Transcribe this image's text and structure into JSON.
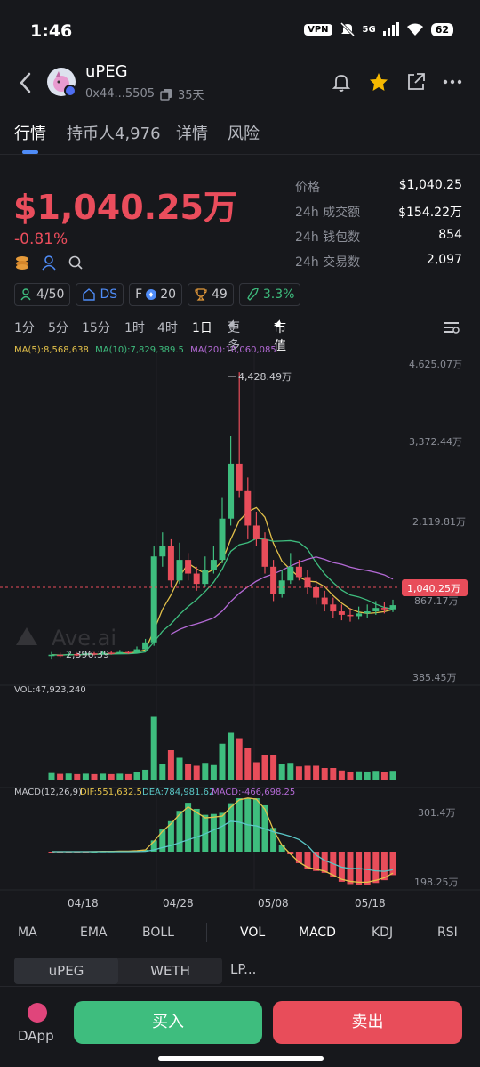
{
  "status": {
    "time": "1:46",
    "vpn": "VPN",
    "net": "5G",
    "battery": "62"
  },
  "header": {
    "name": "uPEG",
    "address": "0x44...5505",
    "age": "35天"
  },
  "tabs": [
    "行情",
    "持币人4,976",
    "详情",
    "风险"
  ],
  "price": {
    "main": "$1,040.25万",
    "change": "-0.81%"
  },
  "stats": [
    {
      "k": "价格",
      "v": "$1,040.25"
    },
    {
      "k": "24h 成交额",
      "v": "$154.22万"
    },
    {
      "k": "24h 钱包数",
      "v": "854"
    },
    {
      "k": "24h 交易数",
      "v": "2,097"
    }
  ],
  "tags": [
    {
      "icon": "holder-icon",
      "text": "4/50"
    },
    {
      "icon": "ds-icon",
      "text": "DS"
    },
    {
      "icon": "f-icon",
      "text": "20",
      "prefix": "F"
    },
    {
      "icon": "trophy-icon",
      "text": "49"
    },
    {
      "icon": "rocket-icon",
      "text": "3.3%"
    }
  ],
  "intervals": [
    "1分",
    "5分",
    "15分",
    "1时",
    "4时",
    "1日",
    "更多",
    "市值"
  ],
  "legend": {
    "ma5": "MA(5):8,568,638",
    "ma10": "MA(10):7,829,389.5",
    "ma20": "MA(20):10,060,085"
  },
  "axis": {
    "y_labels": [
      "4,625.07万",
      "3,372.44万",
      "2,119.81万",
      "867.17万",
      "385.45万"
    ],
    "high_label": "4,428.49万",
    "low_label": "2,396.39",
    "current_label": "1,040.25万",
    "x_labels": [
      "04/18",
      "04/28",
      "05/08",
      "05/18"
    ],
    "vol_label": "VOL:47,923,240",
    "macd_label": "MACD(12,26,9)",
    "dif_label": "DIF:551,632.5",
    "dea_label": "DEA:784,981.62",
    "macdv_label": "MACD:-466,698.25",
    "macd_top": "301.4万",
    "macd_bottom": "198.25万"
  },
  "indicators": [
    "MA",
    "EMA",
    "BOLL",
    "VOL",
    "MACD",
    "KDJ",
    "RSI"
  ],
  "pair": [
    "uPEG",
    "WETH",
    "LP..."
  ],
  "bottom": {
    "dapp": "DApp",
    "buy": "买入",
    "sell": "卖出"
  },
  "colors": {
    "up": "#3ebd7e",
    "down": "#e84d5a",
    "accent": "#4f8cf7"
  },
  "chart_data": {
    "type": "candlestick",
    "x_labels": [
      "04/18",
      "04/28",
      "05/08",
      "05/18"
    ],
    "candles": [
      [
        0.3,
        0.32,
        0.25,
        0.36
      ],
      [
        0.32,
        0.31,
        0.28,
        0.35
      ],
      [
        0.31,
        0.33,
        0.29,
        0.36
      ],
      [
        0.33,
        0.32,
        0.3,
        0.35
      ],
      [
        0.32,
        0.34,
        0.31,
        0.37
      ],
      [
        0.34,
        0.33,
        0.31,
        0.36
      ],
      [
        0.33,
        0.35,
        0.32,
        0.38
      ],
      [
        0.35,
        0.34,
        0.32,
        0.37
      ],
      [
        0.34,
        0.36,
        0.33,
        0.39
      ],
      [
        0.36,
        0.35,
        0.33,
        0.38
      ],
      [
        0.35,
        0.4,
        0.34,
        0.44
      ],
      [
        0.4,
        0.5,
        0.38,
        0.55
      ],
      [
        0.5,
        1.75,
        0.45,
        1.9
      ],
      [
        1.75,
        1.9,
        1.6,
        2.1
      ],
      [
        1.9,
        1.4,
        1.3,
        2.0
      ],
      [
        1.4,
        1.7,
        1.35,
        1.95
      ],
      [
        1.7,
        1.5,
        1.4,
        1.8
      ],
      [
        1.5,
        1.35,
        1.25,
        1.6
      ],
      [
        1.35,
        1.55,
        1.3,
        1.75
      ],
      [
        1.55,
        1.7,
        1.5,
        1.9
      ],
      [
        1.7,
        2.3,
        1.65,
        2.6
      ],
      [
        2.3,
        3.1,
        2.2,
        3.5
      ],
      [
        3.1,
        2.7,
        2.6,
        4.43
      ],
      [
        2.7,
        2.2,
        2.0,
        2.9
      ],
      [
        2.2,
        2.0,
        1.9,
        2.4
      ],
      [
        2.0,
        1.6,
        1.5,
        2.1
      ],
      [
        1.6,
        1.2,
        1.1,
        1.7
      ],
      [
        1.2,
        1.4,
        1.15,
        1.55
      ],
      [
        1.4,
        1.6,
        1.35,
        1.8
      ],
      [
        1.6,
        1.45,
        1.4,
        1.7
      ],
      [
        1.45,
        1.3,
        1.2,
        1.55
      ],
      [
        1.3,
        1.15,
        1.05,
        1.4
      ],
      [
        1.15,
        1.05,
        0.95,
        1.25
      ],
      [
        1.05,
        0.95,
        0.85,
        1.15
      ],
      [
        0.95,
        0.9,
        0.82,
        1.05
      ],
      [
        0.9,
        0.88,
        0.8,
        1.0
      ],
      [
        0.88,
        0.92,
        0.83,
        1.02
      ],
      [
        0.92,
        0.95,
        0.85,
        1.05
      ],
      [
        0.95,
        1.0,
        0.9,
        1.1
      ],
      [
        1.0,
        0.98,
        0.92,
        1.08
      ],
      [
        0.98,
        1.04,
        0.94,
        1.12
      ]
    ]
  }
}
